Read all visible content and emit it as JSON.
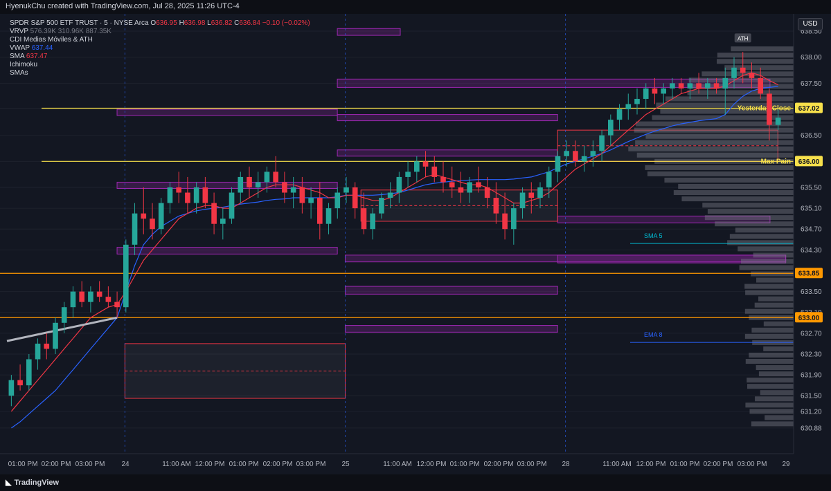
{
  "header": {
    "title": "HyenukChu created with TradingView.com, Jul 28, 2025 11:26 UTC-4"
  },
  "legend": {
    "symbol": "SPDR S&P 500 ETF TRUST · 5 · NYSE Arca",
    "o_label": "O",
    "o": "636.95",
    "h_label": "H",
    "h": "636.98",
    "l_label": "L",
    "l": "636.82",
    "c_label": "C",
    "c": "636.84",
    "chg": "−0.10 (−0.02%)",
    "vrvp_label": "VRVP",
    "vrvp_values": "576.39K  310.96K  887.35K",
    "cdi": "CDI Medias Móviles & ATH",
    "vwap_label": "VWAP",
    "vwap": "637.44",
    "sma_label": "SMA",
    "sma": "637.47",
    "ichimoku": "Ichimoku",
    "smas": "SMAs"
  },
  "currency": "USD",
  "footer": {
    "brand": "TradingView"
  },
  "colors": {
    "bg": "#131722",
    "up": "#26a69a",
    "down": "#f23645",
    "grid": "#1e222d",
    "zone_purple": "#9c27b0",
    "zone_red": "#f23645",
    "orange": "#ff9800",
    "yellow": "#f7e04b",
    "vwap": "#2962ff",
    "sma": "#f23645",
    "sma5": "#00bcd4",
    "ema8": "#2962ff"
  },
  "chart_data": {
    "type": "candlestick",
    "ylim": [
      630.6,
      638.7
    ],
    "yticks": [
      638.5,
      638.0,
      637.5,
      637.02,
      636.5,
      636.0,
      635.5,
      635.1,
      634.7,
      634.3,
      633.85,
      633.5,
      633.1,
      633.0,
      632.7,
      632.3,
      631.9,
      631.5,
      631.2,
      630.88
    ],
    "ytick_labels": [
      "638.50",
      "638.00",
      "637.50",
      "637.02",
      "636.50",
      "636.00",
      "635.50",
      "635.10",
      "634.70",
      "634.30",
      "633.85",
      "633.50",
      "633.10",
      "633.00",
      "632.70",
      "632.30",
      "631.90",
      "631.50",
      "631.20",
      "630.88"
    ],
    "highlighted_ticks": [
      {
        "value": 637.02,
        "label": "637.02",
        "color": "#f7e04b"
      },
      {
        "value": 636.0,
        "label": "636.00",
        "color": "#f7e04b"
      },
      {
        "value": 633.85,
        "label": "633.85",
        "color": "#ff9800"
      },
      {
        "value": 633.0,
        "label": "633.00",
        "color": "#ff9800"
      }
    ],
    "xticks": [
      "01:00 PM",
      "02:00 PM",
      "03:00 PM",
      "24",
      "11:00 AM",
      "12:00 PM",
      "01:00 PM",
      "02:00 PM",
      "03:00 PM",
      "25",
      "11:00 AM",
      "12:00 PM",
      "01:00 PM",
      "02:00 PM",
      "03:00 PM",
      "28",
      "11:00 AM",
      "12:00 PM",
      "01:00 PM",
      "02:00 PM",
      "03:00 PM",
      "29"
    ],
    "session_markers": [
      "24",
      "25",
      "28"
    ],
    "levels": [
      {
        "name": "Yesterday Close",
        "value": 637.02,
        "color": "#f7e04b"
      },
      {
        "name": "Max Pain",
        "value": 636.0,
        "color": "#f7e04b"
      },
      {
        "name": "",
        "value": 633.85,
        "color": "#ff9800"
      },
      {
        "name": "",
        "value": 633.0,
        "color": "#ff9800"
      }
    ],
    "annotations": [
      {
        "text": "ATH",
        "value": 638.35
      },
      {
        "text": "SMA 5",
        "value": 634.45
      },
      {
        "text": "EMA 8",
        "value": 632.55
      }
    ],
    "ohlc": [
      [
        631.5,
        631.9,
        631.3,
        631.8
      ],
      [
        631.8,
        632.1,
        631.6,
        631.7
      ],
      [
        631.7,
        632.3,
        631.6,
        632.2
      ],
      [
        632.2,
        632.6,
        632.0,
        632.5
      ],
      [
        632.5,
        632.7,
        632.2,
        632.4
      ],
      [
        632.4,
        633.0,
        632.3,
        632.9
      ],
      [
        632.9,
        633.3,
        632.7,
        633.2
      ],
      [
        633.2,
        633.6,
        633.0,
        633.5
      ],
      [
        633.5,
        633.7,
        633.2,
        633.3
      ],
      [
        633.3,
        633.6,
        633.1,
        633.5
      ],
      [
        633.5,
        633.7,
        633.3,
        633.4
      ],
      [
        633.4,
        633.6,
        633.2,
        633.3
      ],
      [
        633.3,
        633.5,
        633.0,
        633.2
      ],
      [
        633.2,
        634.5,
        633.1,
        634.4
      ],
      [
        634.4,
        635.2,
        634.2,
        635.0
      ],
      [
        635.0,
        635.5,
        634.6,
        634.9
      ],
      [
        634.9,
        635.2,
        634.5,
        634.7
      ],
      [
        634.7,
        635.3,
        634.6,
        635.2
      ],
      [
        635.2,
        635.6,
        635.0,
        635.5
      ],
      [
        635.5,
        635.8,
        635.2,
        635.4
      ],
      [
        635.4,
        635.7,
        635.0,
        635.2
      ],
      [
        635.2,
        635.6,
        635.0,
        635.5
      ],
      [
        635.5,
        635.7,
        635.1,
        635.2
      ],
      [
        635.2,
        635.4,
        634.6,
        634.8
      ],
      [
        634.8,
        635.1,
        634.5,
        634.9
      ],
      [
        634.9,
        635.5,
        634.8,
        635.4
      ],
      [
        635.4,
        635.8,
        635.2,
        635.7
      ],
      [
        635.7,
        635.9,
        635.3,
        635.5
      ],
      [
        635.5,
        635.8,
        635.3,
        635.6
      ],
      [
        635.6,
        635.9,
        635.4,
        635.8
      ],
      [
        635.8,
        636.1,
        635.5,
        635.6
      ],
      [
        635.6,
        635.8,
        635.2,
        635.4
      ],
      [
        635.4,
        635.7,
        635.1,
        635.5
      ],
      [
        635.5,
        635.7,
        635.0,
        635.2
      ],
      [
        635.2,
        635.5,
        634.9,
        635.3
      ],
      [
        635.3,
        635.6,
        634.5,
        634.8
      ],
      [
        634.8,
        635.2,
        634.6,
        635.1
      ],
      [
        635.1,
        635.5,
        634.9,
        635.4
      ],
      [
        635.4,
        635.7,
        635.2,
        635.5
      ],
      [
        635.5,
        635.6,
        634.9,
        635.1
      ],
      [
        635.1,
        635.4,
        634.6,
        634.7
      ],
      [
        634.7,
        635.1,
        634.5,
        635.0
      ],
      [
        635.0,
        635.4,
        634.9,
        635.3
      ],
      [
        635.3,
        635.6,
        635.1,
        635.4
      ],
      [
        635.4,
        635.8,
        635.2,
        635.7
      ],
      [
        635.7,
        636.0,
        635.5,
        635.8
      ],
      [
        635.8,
        636.1,
        635.6,
        636.0
      ],
      [
        636.0,
        636.2,
        635.7,
        635.9
      ],
      [
        635.9,
        636.1,
        635.6,
        635.7
      ],
      [
        635.7,
        636.0,
        635.4,
        635.6
      ],
      [
        635.6,
        635.9,
        635.3,
        635.5
      ],
      [
        635.5,
        635.8,
        635.2,
        635.4
      ],
      [
        635.4,
        635.7,
        635.2,
        635.6
      ],
      [
        635.6,
        635.9,
        635.4,
        635.5
      ],
      [
        635.5,
        635.7,
        635.1,
        635.3
      ],
      [
        635.3,
        635.6,
        634.8,
        635.0
      ],
      [
        635.0,
        635.4,
        634.5,
        634.7
      ],
      [
        634.7,
        635.2,
        634.4,
        635.1
      ],
      [
        635.1,
        635.5,
        634.9,
        635.4
      ],
      [
        635.4,
        635.6,
        635.0,
        635.3
      ],
      [
        635.3,
        635.6,
        635.1,
        635.5
      ],
      [
        635.5,
        635.9,
        635.3,
        635.8
      ],
      [
        635.8,
        636.2,
        635.6,
        636.1
      ],
      [
        636.1,
        636.4,
        635.9,
        636.2
      ],
      [
        636.2,
        636.4,
        635.9,
        636.0
      ],
      [
        636.0,
        636.3,
        635.8,
        636.1
      ],
      [
        636.1,
        636.4,
        635.9,
        636.2
      ],
      [
        636.2,
        636.6,
        636.0,
        636.5
      ],
      [
        636.5,
        636.9,
        636.3,
        636.8
      ],
      [
        636.8,
        637.1,
        636.6,
        637.0
      ],
      [
        637.0,
        637.3,
        636.8,
        637.1
      ],
      [
        637.1,
        637.4,
        636.9,
        637.2
      ],
      [
        637.2,
        637.5,
        637.0,
        637.4
      ],
      [
        637.4,
        637.6,
        637.1,
        637.3
      ],
      [
        637.3,
        637.5,
        637.1,
        637.4
      ],
      [
        637.4,
        637.6,
        637.2,
        637.5
      ],
      [
        637.5,
        637.6,
        637.3,
        637.4
      ],
      [
        637.4,
        637.6,
        637.2,
        637.5
      ],
      [
        637.5,
        637.7,
        637.3,
        637.4
      ],
      [
        637.4,
        637.6,
        637.2,
        637.5
      ],
      [
        637.5,
        637.6,
        637.3,
        637.4
      ],
      [
        637.4,
        637.8,
        636.9,
        637.6
      ],
      [
        637.6,
        638.0,
        637.4,
        637.8
      ],
      [
        637.8,
        638.1,
        637.5,
        637.7
      ],
      [
        637.7,
        637.9,
        637.4,
        637.6
      ],
      [
        637.6,
        637.8,
        637.2,
        637.3
      ],
      [
        637.3,
        637.4,
        636.4,
        636.7
      ],
      [
        636.7,
        637.0,
        636.6,
        636.84
      ]
    ],
    "vwap": [
      630.88,
      631.0,
      631.15,
      631.3,
      631.45,
      631.6,
      631.8,
      632.0,
      632.2,
      632.4,
      632.6,
      632.8,
      633.0,
      633.5,
      634.0,
      634.4,
      634.6,
      634.75,
      634.85,
      634.95,
      635.0,
      635.05,
      635.08,
      635.1,
      635.12,
      635.15,
      635.18,
      635.2,
      635.22,
      635.25,
      635.27,
      635.28,
      635.3,
      635.3,
      635.3,
      635.3,
      635.3,
      635.32,
      635.35,
      635.35,
      635.35,
      635.35,
      635.36,
      635.38,
      635.4,
      635.45,
      635.5,
      635.55,
      635.58,
      635.6,
      635.62,
      635.63,
      635.64,
      635.65,
      635.65,
      635.65,
      635.65,
      635.66,
      635.68,
      635.7,
      635.75,
      635.8,
      635.88,
      635.95,
      636.0,
      636.05,
      636.1,
      636.15,
      636.22,
      636.3,
      636.38,
      636.45,
      636.52,
      636.58,
      636.63,
      636.68,
      636.72,
      636.75,
      636.78,
      636.8,
      636.82,
      636.9,
      637.1,
      637.25,
      637.35,
      637.4,
      637.42,
      637.44
    ],
    "sma": [
      631.2,
      631.4,
      631.6,
      631.8,
      632.0,
      632.2,
      632.4,
      632.6,
      632.8,
      633.0,
      633.1,
      633.2,
      633.25,
      633.5,
      633.8,
      634.1,
      634.3,
      634.5,
      634.7,
      634.9,
      635.0,
      635.1,
      635.15,
      635.15,
      635.1,
      635.1,
      635.2,
      635.3,
      635.4,
      635.5,
      635.55,
      635.55,
      635.55,
      635.5,
      635.45,
      635.4,
      635.3,
      635.3,
      635.35,
      635.35,
      635.3,
      635.25,
      635.25,
      635.3,
      635.4,
      635.5,
      635.6,
      635.7,
      635.75,
      635.7,
      635.65,
      635.6,
      635.55,
      635.55,
      635.5,
      635.4,
      635.3,
      635.2,
      635.2,
      635.25,
      635.3,
      635.4,
      635.55,
      635.7,
      635.85,
      635.95,
      636.05,
      636.15,
      636.3,
      636.45,
      636.6,
      636.75,
      636.9,
      637.0,
      637.1,
      637.2,
      637.3,
      637.35,
      637.4,
      637.4,
      637.4,
      637.45,
      637.55,
      637.65,
      637.7,
      637.65,
      637.55,
      637.47
    ]
  }
}
